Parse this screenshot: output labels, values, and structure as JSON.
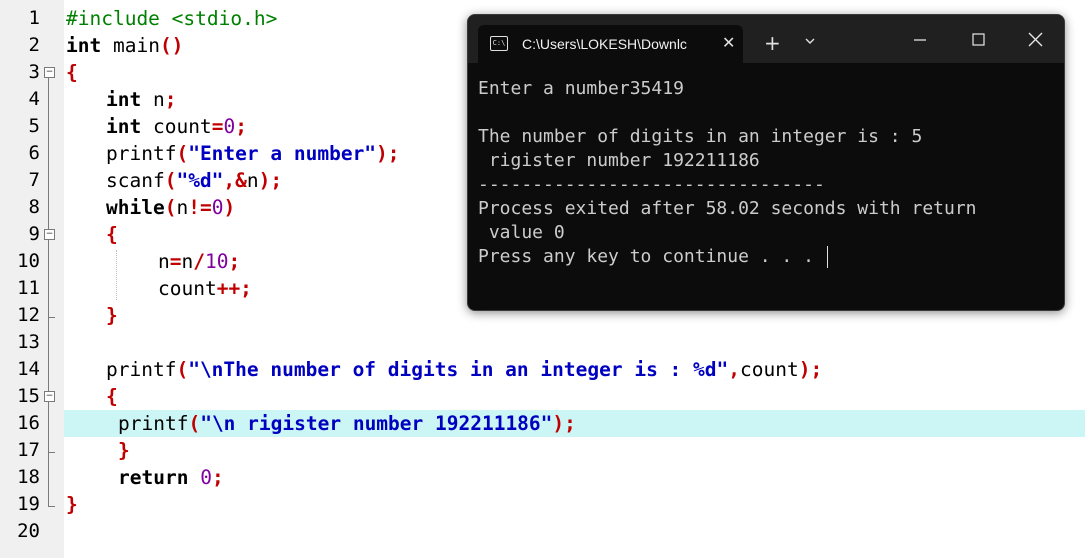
{
  "editor": {
    "line_numbers": [
      "1",
      "2",
      "3",
      "4",
      "5",
      "6",
      "7",
      "8",
      "9",
      "10",
      "11",
      "12",
      "13",
      "14",
      "15",
      "16",
      "17",
      "18",
      "19",
      "20"
    ],
    "code": {
      "l1": "#include <stdio.h>",
      "l2_kw": "int",
      "l2_name": " main",
      "l2_sym": "()",
      "l3_sym": "{",
      "l4_kw": "int",
      "l4_rest": " n",
      "l4_sym": ";",
      "l5_kw": "int",
      "l5_rest": " count",
      "l5_eq": "=",
      "l5_num": "0",
      "l5_semi": ";",
      "l6_fn": "printf",
      "l6_open": "(",
      "l6_str": "\"Enter a number\"",
      "l6_close": ");",
      "l7_fn": "scanf",
      "l7_open": "(",
      "l7_str": "\"%d\"",
      "l7_comma": ",&",
      "l7_var": "n",
      "l7_close": ");",
      "l8_kw": "while",
      "l8_open": "(",
      "l8_var": "n",
      "l8_op": "!=",
      "l8_num": "0",
      "l8_close": ")",
      "l9_sym": "{",
      "l10_var": "n",
      "l10_eq": "=",
      "l10_var2": "n",
      "l10_op": "/",
      "l10_num": "10",
      "l10_semi": ";",
      "l11_var": "count",
      "l11_op": "++;",
      "l12_sym": "}",
      "l14_fn": "printf",
      "l14_open": "(",
      "l14_str": "\"\\nThe number of digits in an integer is : %d\"",
      "l14_comma": ",",
      "l14_var": "count",
      "l14_close": ");",
      "l15_sym": "{",
      "l16_fn": "printf",
      "l16_open": "(",
      "l16_str": "\"\\n rigister number 192211186\"",
      "l16_close": ");",
      "l17_sym": "}",
      "l18_kw": "return",
      "l18_num": "0",
      "l18_semi": ";",
      "l19_sym": "}"
    }
  },
  "terminal": {
    "tab_title": "C:\\Users\\LOKESH\\Downlc",
    "tab_icon": "console-icon",
    "output_lines": [
      "Enter a number35419",
      "",
      "The number of digits in an integer is : 5",
      " rigister number 192211186",
      "--------------------------------",
      "Process exited after 58.02 seconds with return",
      " value 0",
      "Press any key to continue . . . "
    ]
  },
  "colors": {
    "keyword": "#000000",
    "symbol": "#c00000",
    "number": "#8000a0",
    "string": "#0000c0",
    "preprocessor": "#008000",
    "current_line": "#ccf5f5",
    "terminal_bg": "#0c0c0c",
    "terminal_text": "#cccccc"
  }
}
